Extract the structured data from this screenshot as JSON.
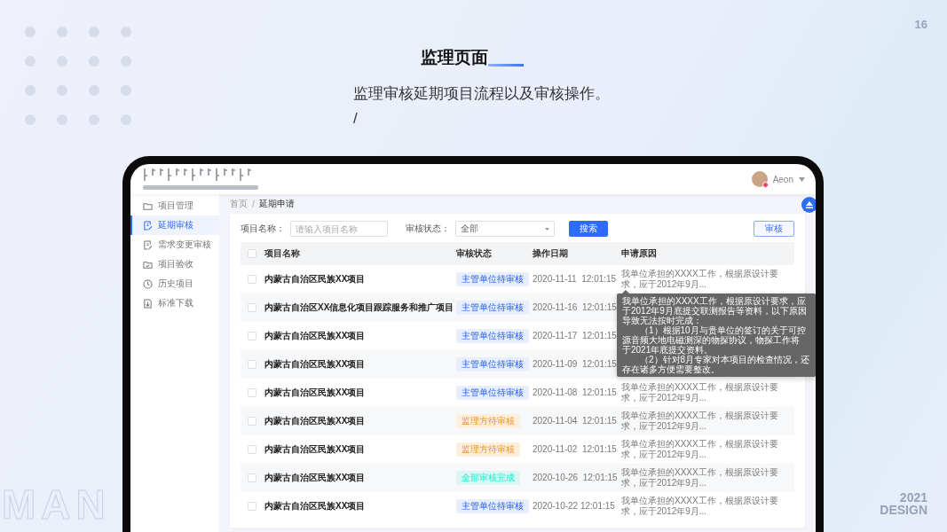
{
  "slide": {
    "page_number": "16",
    "title": "监理页面",
    "description": "监理审核延期项目流程以及审核操作。",
    "description_mark": "/",
    "watermark_word": "MAN",
    "year": "2021",
    "design_label": "DESIGN"
  },
  "header": {
    "user_name": "Aeon"
  },
  "sidebar": {
    "items": [
      {
        "label": "项目管理",
        "kind": "folder",
        "selected": false
      },
      {
        "label": "延期审核",
        "kind": "edit",
        "selected": true
      },
      {
        "label": "需求变更审核",
        "kind": "edit",
        "selected": false
      },
      {
        "label": "项目验收",
        "kind": "check",
        "selected": false
      },
      {
        "label": "历史项目",
        "kind": "clock",
        "selected": false
      },
      {
        "label": "标准下载",
        "kind": "download",
        "selected": false
      }
    ]
  },
  "breadcrumb": {
    "separator": "/",
    "items": [
      {
        "label": "首页",
        "selected": false
      },
      {
        "label": "延期申请",
        "selected": true
      }
    ]
  },
  "filters": {
    "name_label": "项目名称：",
    "name_placeholder": "请输入项目名称",
    "status_label": "审核状态：",
    "status_value": "全部",
    "search_button": "搜索",
    "review_button": "审核"
  },
  "table": {
    "header_checked": false,
    "columns": [
      "项目名称",
      "审核状态",
      "操作日期",
      "申请原因"
    ],
    "rows": [
      {
        "checked": false,
        "name": "内蒙古自治区民族XX项目",
        "status": "主管单位待审核",
        "color": "#e7eefe",
        "date": "2020-11-11  12:01:15",
        "reason": "我单位承担的XXXX工作，根据原设计要求，应于2012年9月...",
        "tooltip": [
          {
            "text": "我单位承担的XXXX工作，根据原设计要求，应于2012年9月底提交联测报告等资料，以下原因导致无法按时完成：",
            "indent": false
          },
          {
            "text": "（1）根据10月与贵单位的签订的关于可控源音频大地电磁测深的物探协议，物探工作将",
            "indent": true
          },
          {
            "text": "于2021年底提交资料。",
            "indent": false
          },
          {
            "text": "（2）针对8月专家对本项目的检查情况，还存在诸多方便需要整改。",
            "indent": true
          }
        ]
      },
      {
        "checked": false,
        "name": "内蒙古自治区XX信息化项目跟踪服务和推广项目",
        "status": "主管单位待审核",
        "color": "#e7eefe",
        "date": "2020-11-16  12:01:15"
      },
      {
        "checked": false,
        "name": "内蒙古自治区民族XX项目",
        "status": "主管单位待审核",
        "color": "#e7eefe",
        "date": "2020-11-17  12:01:15"
      },
      {
        "checked": false,
        "name": "内蒙古自治区民族XX项目",
        "status": "主管单位待审核",
        "color": "#e7eefe",
        "date": "2020-11-09  12:01:15"
      },
      {
        "checked": false,
        "name": "内蒙古自治区民族XX项目",
        "status": "主管单位待审核",
        "color": "#e7eefe",
        "date": "2020-11-08  12:01:15",
        "reason": "我单位承担的XXXX工作，根据原设计要求，应于2012年9月..."
      },
      {
        "checked": false,
        "name": "内蒙古自治区民族XX项目",
        "status": "监理方待审核",
        "color": "#fdefdb",
        "date": "2020-11-04  12:01:15",
        "reason": "我单位承担的XXXX工作，根据原设计要求，应于2012年9月..."
      },
      {
        "checked": false,
        "name": "内蒙古自治区民族XX项目",
        "status": "监理方待审核",
        "color": "#fdefdb",
        "date": "2020-11-02  12:01:15",
        "reason": "我单位承担的XXXX工作，根据原设计要求，应于2012年9月..."
      },
      {
        "checked": false,
        "name": "内蒙古自治区民族XX项目",
        "status": "全部审核完成",
        "color": "#dbf6f3",
        "date": "2020-10-26  12:01:15",
        "reason": "我单位承担的XXXX工作，根据原设计要求，应于2012年9月..."
      },
      {
        "checked": false,
        "name": "内蒙古自治区民族XX项目",
        "status": "主管单位待审核",
        "color": "#e7eefe",
        "date": "2020-10-22 12:01:15",
        "reason": "我单位承担的XXXX工作，根据原设计要求，应于2012年9月..."
      }
    ]
  }
}
